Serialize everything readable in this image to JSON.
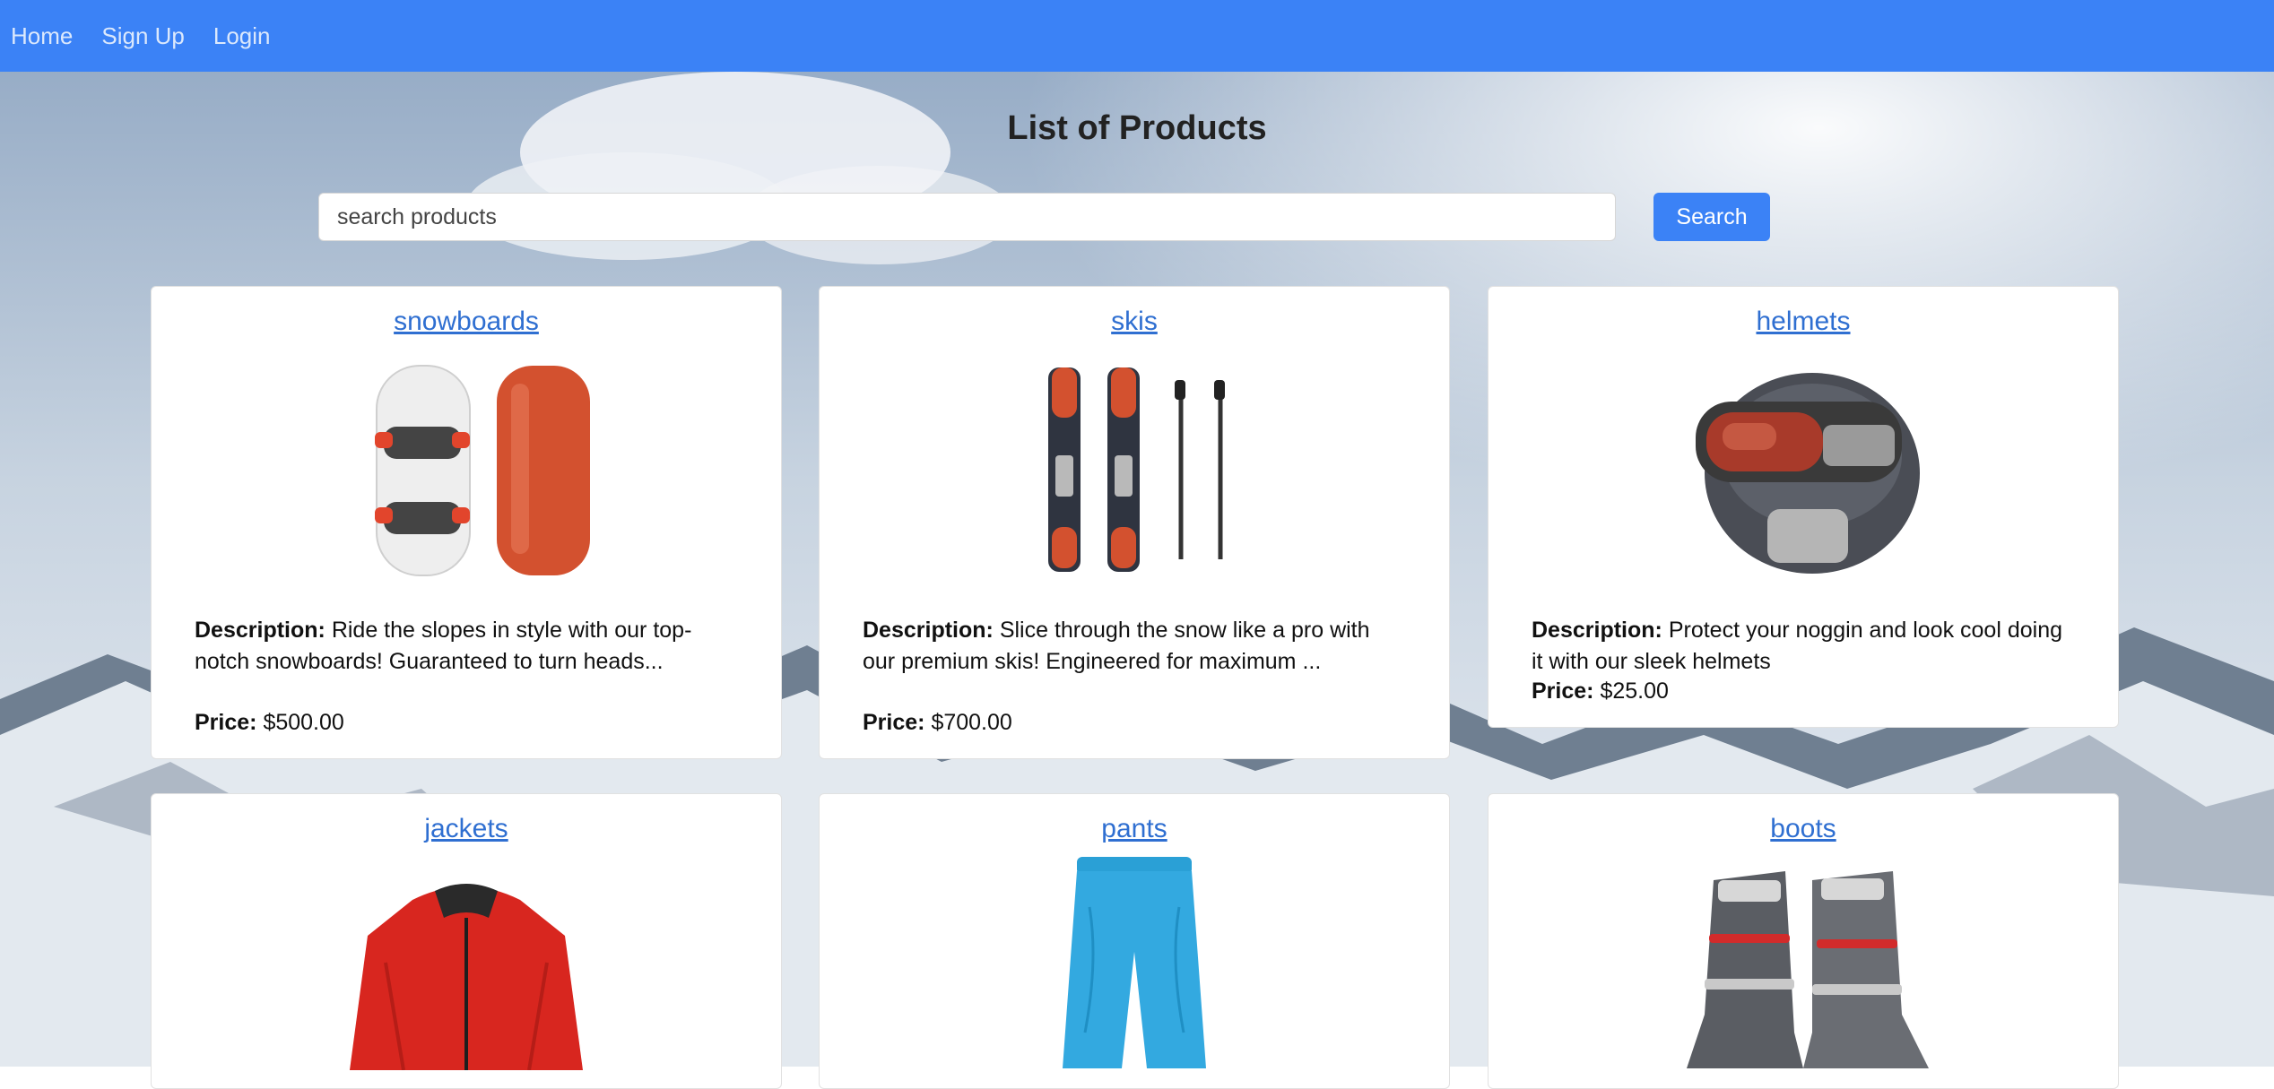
{
  "nav": {
    "links": [
      "Home",
      "Sign Up",
      "Login"
    ]
  },
  "page": {
    "title": "List of Products"
  },
  "search": {
    "placeholder": "search products",
    "value": "",
    "button_label": "Search"
  },
  "labels": {
    "description": "Description:",
    "price": "Price:"
  },
  "products": [
    {
      "name": "snowboards",
      "icon": "snowboard-image",
      "description": "Ride the slopes in style with our top-notch snowboards! Guaranteed to turn heads...",
      "price": "$500.00"
    },
    {
      "name": "skis",
      "icon": "skis-image",
      "description": "Slice through the snow like a pro with our premium skis! Engineered for maximum ...",
      "price": "$700.00"
    },
    {
      "name": "helmets",
      "icon": "helmet-image",
      "description": "Protect your noggin and look cool doing it with our sleek helmets",
      "price": "$25.00"
    },
    {
      "name": "jackets",
      "icon": "jacket-image"
    },
    {
      "name": "pants",
      "icon": "pants-image"
    },
    {
      "name": "boots",
      "icon": "boots-image"
    }
  ],
  "colors": {
    "nav_background": "#3b82f6",
    "link": "#2f6fd1",
    "button": "#3b82f6"
  }
}
